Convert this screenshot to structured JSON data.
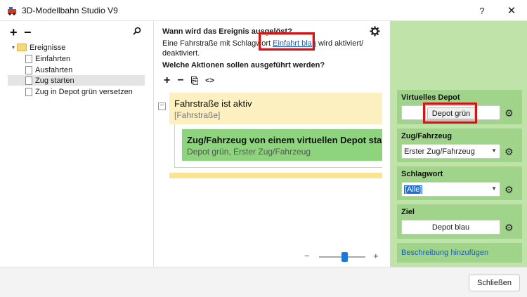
{
  "window": {
    "title": "3D-Modellbahn Studio V9",
    "help": "?",
    "close": "✕"
  },
  "tree": {
    "toolbar": {
      "add": "+",
      "remove": "−",
      "search": "⌕"
    },
    "root": {
      "label": "Ereignisse",
      "expanded": true
    },
    "items": [
      {
        "label": "Einfahrten"
      },
      {
        "label": "Ausfahrten"
      },
      {
        "label": "Zug starten",
        "selected": true
      },
      {
        "label": "Zug in Depot grün versetzen"
      }
    ]
  },
  "event": {
    "trigger_question": "Wann wird das Ereignis ausgelöst?",
    "desc_prefix": "Eine Fahrstraße mit Schlagwort ",
    "desc_link": "Einfahrt blau",
    "desc_suffix": " wird aktiviert/",
    "desc_line2": "deaktiviert.",
    "actions_question": "Welche Aktionen sollen ausgeführt werden?",
    "toolbar": {
      "add": "+",
      "remove": "−",
      "copy": "⎘",
      "code": "<>"
    },
    "condition": {
      "title": "Fahrstraße ist aktiv",
      "subtitle": "[Fahrstraße]",
      "collapse": "−"
    },
    "action": {
      "title": "Zug/Fahrzeug von einem virtuellen Depot starten",
      "subtitle": "Depot grün, Erster Zug/Fahrzeug"
    },
    "zoom": {
      "minus": "−",
      "plus": "+",
      "level": 0.55
    }
  },
  "properties": {
    "virtual_depot": {
      "label": "Virtuelles Depot",
      "value": "Depot grün"
    },
    "vehicle": {
      "label": "Zug/Fahrzeug",
      "value": "Erster Zug/Fahrzeug"
    },
    "keyword": {
      "label": "Schlagwort",
      "value": "[Alle]"
    },
    "target": {
      "label": "Ziel",
      "value": "Depot blau"
    },
    "add_description": "Beschreibung hinzufügen"
  },
  "footer": {
    "close_label": "Schließen"
  },
  "colors": {
    "condition_bg": "#fdf0c0",
    "action_bg": "#8ed37e",
    "properties_bg": "#bfe3a9",
    "property_box_bg": "#9fd48a",
    "highlight": "#d21414",
    "link": "#1a5fb4"
  }
}
